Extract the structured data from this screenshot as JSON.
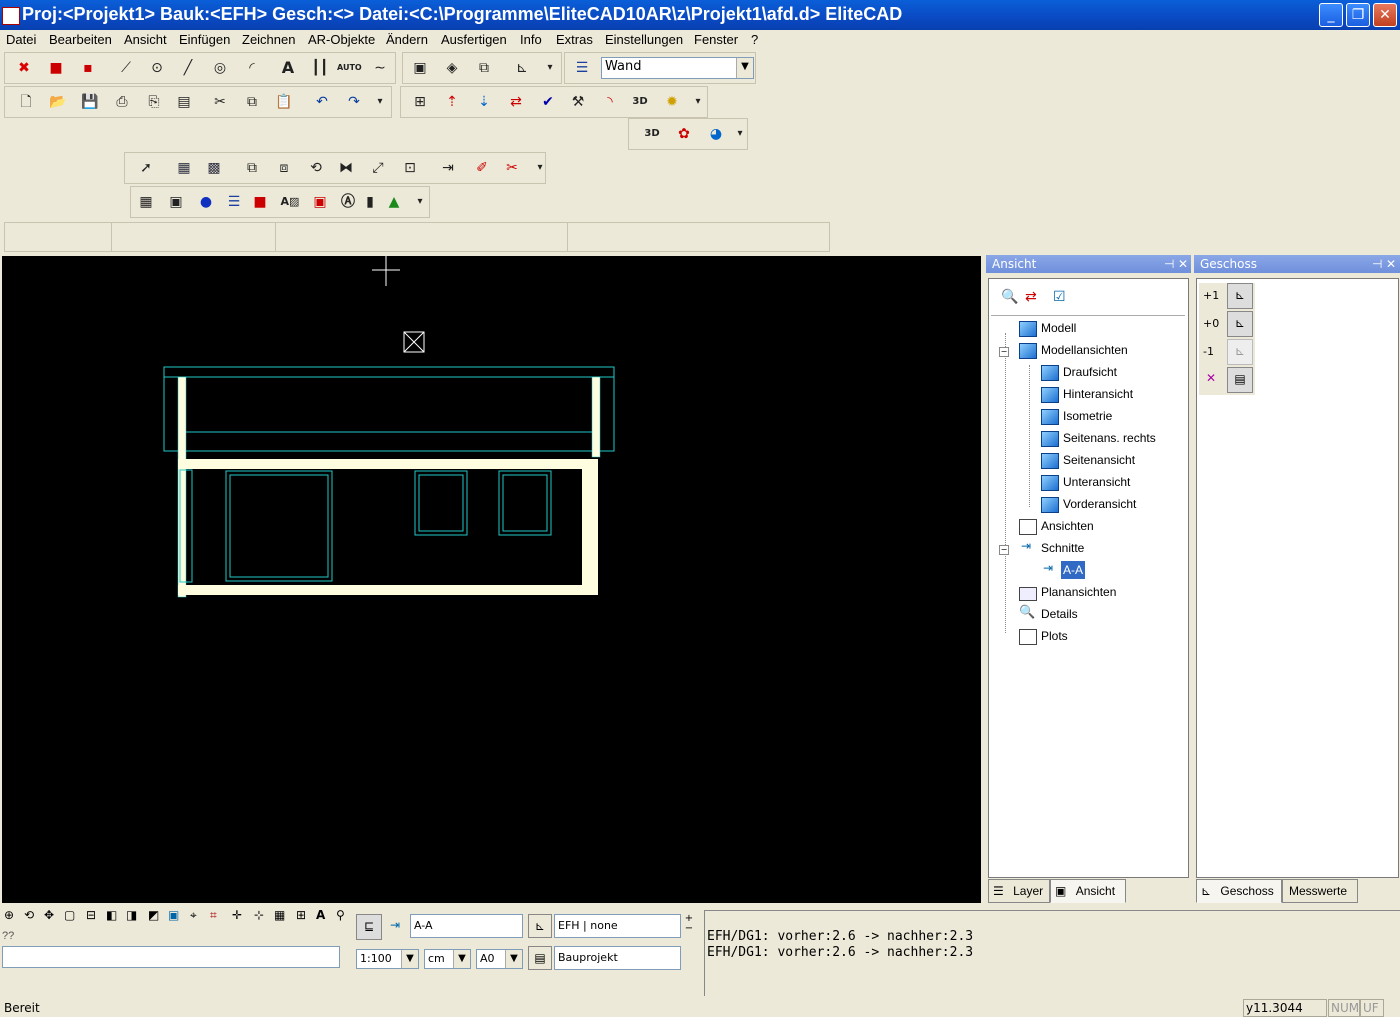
{
  "window": {
    "title": "Proj:<Projekt1> Bauk:<EFH>  Gesch:<>  Datei:<C:\\Programme\\EliteCAD10AR\\z\\Projekt1\\afd.d> EliteCAD"
  },
  "menu": {
    "items": [
      "Datei",
      "Bearbeiten",
      "Ansicht",
      "Einfügen",
      "Zeichnen",
      "AR-Objekte",
      "Ändern",
      "Ausfertigen",
      "Info",
      "Extras",
      "Einstellungen",
      "Fenster",
      "?"
    ]
  },
  "toolbar": {
    "layer_select": "Wand",
    "auto_label": "AUTO"
  },
  "ansicht_panel": {
    "title": "Ansicht",
    "tree": [
      {
        "label": "Modell"
      },
      {
        "label": "Modellansichten"
      },
      {
        "label": "Draufsicht"
      },
      {
        "label": "Hinteransicht"
      },
      {
        "label": "Isometrie"
      },
      {
        "label": "Seitenans. rechts"
      },
      {
        "label": "Seitenansicht"
      },
      {
        "label": "Unteransicht"
      },
      {
        "label": "Vorderansicht"
      },
      {
        "label": "Ansichten"
      },
      {
        "label": "Schnitte"
      },
      {
        "label": "A-A"
      },
      {
        "label": "Planansichten"
      },
      {
        "label": "Details"
      },
      {
        "label": "Plots"
      }
    ],
    "tabs": [
      "Layer",
      "Ansicht"
    ]
  },
  "geschoss_panel": {
    "title": "Geschoss",
    "levels": [
      "+1",
      "+0",
      "-1"
    ],
    "tabs": [
      "Geschoss",
      "Messwerte"
    ]
  },
  "bottom": {
    "prompt": "??",
    "view_select": "A-A",
    "floor_select": "EFH | none",
    "project_select": "Bauprojekt",
    "scale": "1:100",
    "unit": "cm",
    "paper": "A0"
  },
  "messages": [
    "EFH/DG1: vorher:2.6 -> nachher:2.3",
    "EFH/DG1: vorher:2.6 -> nachher:2.3"
  ],
  "status": {
    "ready": "Bereit",
    "coord": "y11.3044",
    "num": "NUM",
    "uf": "UF"
  },
  "colors": {
    "canvas": "#000000",
    "drawing_cyan": "#20c8c8",
    "drawing_wall": "#fffde0",
    "titlebar": "#0a49c2"
  }
}
